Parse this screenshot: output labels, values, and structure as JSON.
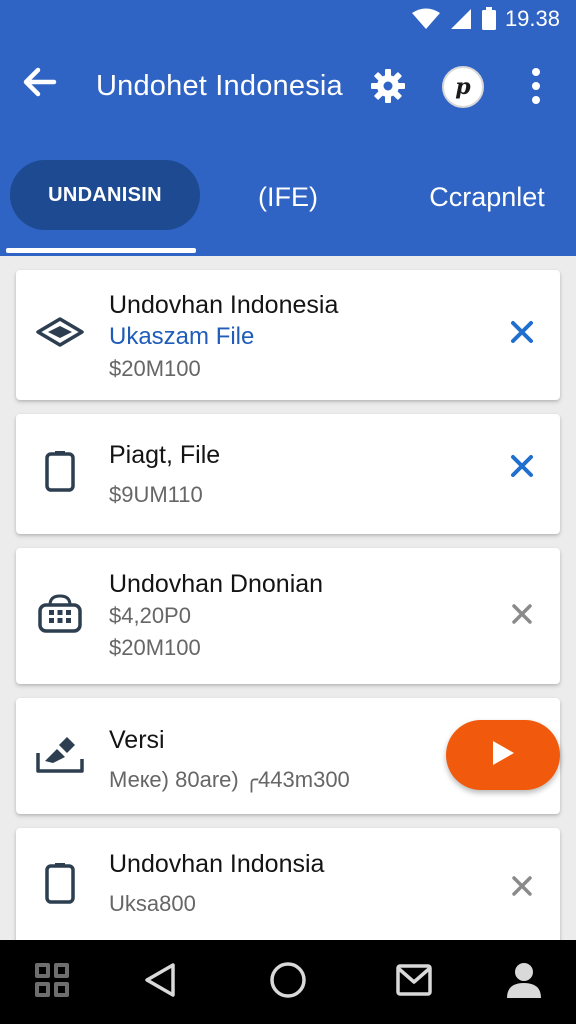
{
  "status_bar": {
    "time": "19.38",
    "icons": [
      "wifi-icon",
      "signal-icon",
      "battery-icon"
    ]
  },
  "toolbar": {
    "title": "Undohet Indonesia",
    "back_icon": "arrow-left-icon",
    "settings_icon": "gear-icon",
    "profile_badge_letter": "p",
    "more_icon": "more-vertical-icon"
  },
  "tabs": [
    {
      "label": "UNDANISIN",
      "active": true
    },
    {
      "label": "(IFE)",
      "active": false
    },
    {
      "label": "Ccrapnlet",
      "active": false
    }
  ],
  "items": [
    {
      "icon": "diamond-icon",
      "title": "Undovhan Indonesia",
      "lines": [
        "Ukaszam File",
        "$20M100"
      ],
      "action": "close-icon",
      "action_color": "#1f6fcf"
    },
    {
      "icon": "phone-icon",
      "title": "Piagt, File",
      "lines": [
        "$9UM110"
      ],
      "action": "close-icon",
      "action_color": "#1f6fcf"
    },
    {
      "icon": "basket-icon",
      "title": "Undovhan Dnonian",
      "lines": [
        "$4,20P0",
        "$20M100"
      ],
      "action": "close-icon",
      "action_color": "#8a8a8a"
    },
    {
      "icon": "edit-tray-icon",
      "title": "Versi",
      "lines": [
        "Мекe) 80are) ╭443m300"
      ],
      "action": "play-fab"
    },
    {
      "icon": "phone-icon",
      "title": "Undovhan Indonsia",
      "lines": [
        "Uksa800"
      ],
      "action": "close-icon",
      "action_color": "#8a8a8a"
    }
  ],
  "fab": {
    "icon": "play-icon",
    "color": "#f15a0d"
  },
  "nav_bar": {
    "icons": [
      "grid-icon",
      "back-triangle-icon",
      "home-circle-icon",
      "mail-icon",
      "person-icon"
    ]
  },
  "colors": {
    "primary": "#2f63c4",
    "tab_active": "#1d4a91",
    "accent": "#f15a0d",
    "link": "#1f5db8"
  }
}
